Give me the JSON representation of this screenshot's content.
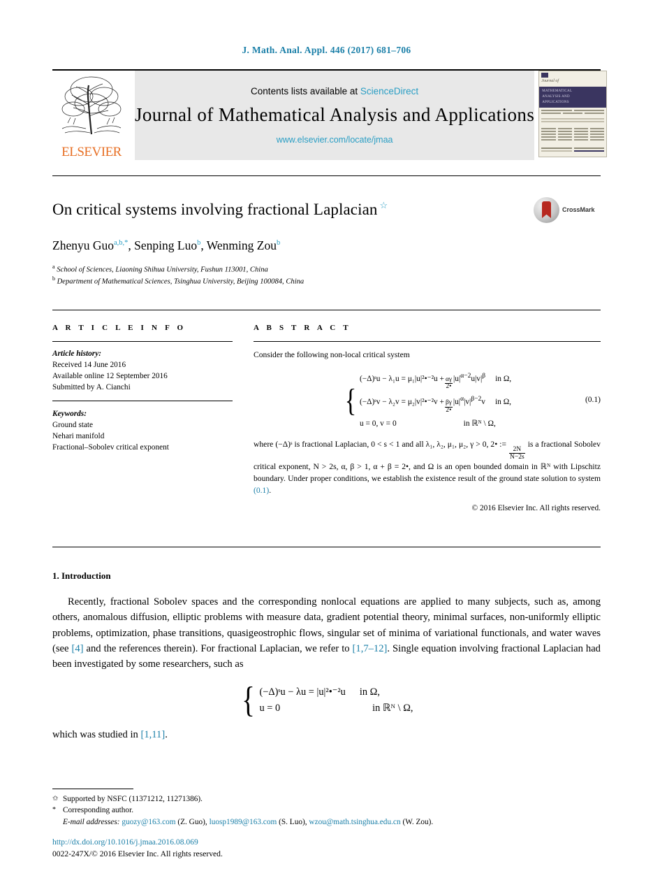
{
  "running_head": "J. Math. Anal. Appl. 446 (2017) 681–706",
  "masthead": {
    "contents_prefix": "Contents lists available at",
    "sciencedirect": "ScienceDirect",
    "journal_title": "Journal of Mathematical Analysis and Applications",
    "journal_url": "www.elsevier.com/locate/jmaa",
    "publisher": "ELSEVIER",
    "cover": {
      "line_journal": "Journal of",
      "band_line1": "MATHEMATICAL",
      "band_line2": "ANALYSIS AND",
      "band_line3": "APPLICATIONS"
    }
  },
  "title": {
    "text": "On critical systems involving fractional Laplacian",
    "star": "☆"
  },
  "authors": [
    {
      "name": "Zhenyu Guo",
      "marks": "a,b,*"
    },
    {
      "name": "Senping Luo",
      "marks": "b"
    },
    {
      "name": "Wenming Zou",
      "marks": "b"
    }
  ],
  "affiliations": [
    {
      "mark": "a",
      "text": "School of Sciences, Liaoning Shihua University, Fushun 113001, China"
    },
    {
      "mark": "b",
      "text": "Department of Mathematical Sciences, Tsinghua University, Beijing 100084, China"
    }
  ],
  "crossmark_label": "CrossMark",
  "article_info": {
    "label": "A R T I C L E   I N F O",
    "history_head": "Article history:",
    "history": [
      "Received 14 June 2016",
      "Available online 12 September 2016",
      "Submitted by A. Cianchi"
    ],
    "keywords_head": "Keywords:",
    "keywords": [
      "Ground state",
      "Nehari manifold",
      "Fractional–Sobolev critical exponent"
    ]
  },
  "abstract": {
    "label": "A B S T R A C T",
    "intro": "Consider the following non-local critical system",
    "equation": {
      "tag": "(0.1)",
      "lines": [
        {
          "lhs": "(−Δ)ˢu − λ₁u = μ₁|u|²•⁻²u + ",
          "frac_num": "αγ",
          "frac_den": "2•",
          "rhs": "|u|^{α−2}u|v|^{β}",
          "cond": "in Ω,"
        },
        {
          "lhs": "(−Δ)ˢv − λ₂v = μ₂|v|²•⁻²v + ",
          "frac_num": "βγ",
          "frac_den": "2•",
          "rhs": "|u|^{α}|v|^{β−2}v",
          "cond": "in Ω,"
        },
        {
          "lhs": "u = 0,  v = 0",
          "frac_num": "",
          "frac_den": "",
          "rhs": "",
          "cond": "in ℝᴺ \\ Ω,"
        }
      ]
    },
    "body_parts": {
      "p1": "where (−Δ)ˢ is fractional Laplacian, 0 < s < 1 and all λ₁, λ₂, μ₁, μ₂, γ > 0, 2• := ",
      "frac_num": "2N",
      "frac_den": "N−2s",
      "p2": " is a fractional Sobolev critical exponent, N > 2s, α, β > 1, α + β = 2•, and Ω is an open bounded domain in ℝᴺ with Lipschitz boundary. Under proper conditions, we establish the existence result of the ground state solution to system ",
      "eqref": "(0.1)",
      "p3": "."
    },
    "copyright": "© 2016 Elsevier Inc. All rights reserved."
  },
  "introduction": {
    "heading": "1. Introduction",
    "para1_a": "Recently, fractional Sobolev spaces and the corresponding nonlocal equations are applied to many subjects, such as, among others, anomalous diffusion, elliptic problems with measure data, gradient potential theory, minimal surfaces, non-uniformly elliptic problems, optimization, phase transitions, quasigeostrophic flows, singular set of minima of variational functionals, and water waves (see ",
    "ref1": "[4]",
    "para1_b": " and the references therein). For fractional Laplacian, we refer to ",
    "ref2": "[1,7–12]",
    "para1_c": ". Single equation involving fractional Laplacian had been investigated by some researchers, such as",
    "equation": {
      "line1_lhs": "(−Δ)ˢu − λu = |u|²•⁻²u",
      "line1_cond": "in Ω,",
      "line2_lhs": "u = 0",
      "line2_cond": "in ℝᴺ \\ Ω,"
    },
    "para2_a": "which was studied in ",
    "ref3": "[1,11]",
    "para2_b": "."
  },
  "footnotes": {
    "support_mark": "✩",
    "support": "Supported by NSFC (11371212, 11271386).",
    "corresponding_mark": "*",
    "corresponding": "Corresponding author.",
    "email_label": "E-mail addresses:",
    "emails": [
      {
        "address": "guozy@163.com",
        "who": "(Z. Guo),"
      },
      {
        "address": "luosp1989@163.com",
        "who": "(S. Luo),"
      },
      {
        "address": "wzou@math.tsinghua.edu.cn",
        "who": "(W. Zou)."
      }
    ]
  },
  "doi": {
    "url": "http://dx.doi.org/10.1016/j.jmaa.2016.08.069",
    "issn_line": "0022-247X/© 2016 Elsevier Inc. All rights reserved."
  },
  "colors": {
    "link": "#1a7fa8",
    "banner_link": "#2a9ec4",
    "elsevier_orange": "#e76f24"
  }
}
